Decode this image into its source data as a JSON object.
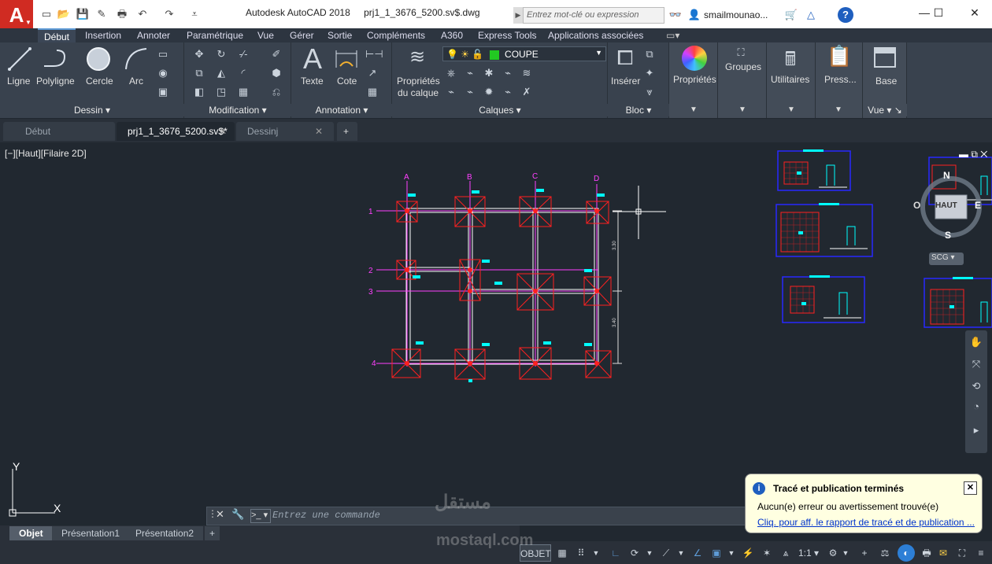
{
  "app": {
    "logo": "A",
    "title": "Autodesk AutoCAD 2018",
    "filename": "prj1_1_3676_5200.sv$.dwg",
    "search_placeholder": "Entrez mot-clé ou expression",
    "user": "smailmounao...",
    "help": "?"
  },
  "menu_tabs": [
    "Début",
    "Insertion",
    "Annoter",
    "Paramétrique",
    "Vue",
    "Gérer",
    "Sortie",
    "Compléments",
    "A360",
    "Express Tools",
    "Applications associées"
  ],
  "ribbon": {
    "dessin": {
      "title": "Dessin",
      "tools": [
        "Ligne",
        "Polyligne",
        "Cercle",
        "Arc"
      ]
    },
    "modification": {
      "title": "Modification"
    },
    "annotation": {
      "title": "Annotation",
      "tools": [
        "Texte",
        "Cote"
      ]
    },
    "calques": {
      "title": "Calques",
      "props_label_1": "Propriétés",
      "props_label_2": "du calque",
      "layer_name": "COUPE"
    },
    "bloc": {
      "title": "Bloc",
      "insert": "Insérer"
    },
    "proprietes": "Propriétés",
    "groupes": "Groupes",
    "utilitaires": "Utilitaires",
    "presse": "Press...",
    "base": "Base",
    "vue": "Vue"
  },
  "doc_tabs": [
    "Début",
    "prj1_1_3676_5200.sv$*",
    "Dessinj"
  ],
  "viewport_label": "[−][Haut][Filaire 2D]",
  "viewcube": {
    "top": "HAUT",
    "n": "N",
    "s": "S",
    "e": "E",
    "o": "O",
    "ucs": "SCG"
  },
  "grid_labels": {
    "cols": [
      "A",
      "B",
      "C",
      "D"
    ],
    "rows": [
      "1",
      "2",
      "3",
      "4"
    ],
    "dim1": "3.30",
    "dim2": "3.40"
  },
  "ucs": {
    "y": "Y",
    "x": "X"
  },
  "command": {
    "placeholder": "Entrez une commande"
  },
  "layout_tabs": [
    "Objet",
    "Présentation1",
    "Présentation2"
  ],
  "status": {
    "model": "OBJET",
    "scale": "1:1"
  },
  "notification": {
    "title": "Tracé et publication terminés",
    "body": "Aucun(e) erreur ou avertissement trouvé(e)",
    "link": "Cliq. pour aff. le rapport de tracé et de publication ..."
  },
  "watermark": {
    "arabic": "مستقل",
    "latin": "mostaql.com"
  },
  "colors": {
    "accent": "#5e9bd6",
    "canvas": "#212830",
    "ribbon": "#39424e",
    "drawing_red": "#ff2020",
    "drawing_magenta": "#ff40ff",
    "drawing_cyan": "#00ffff"
  }
}
